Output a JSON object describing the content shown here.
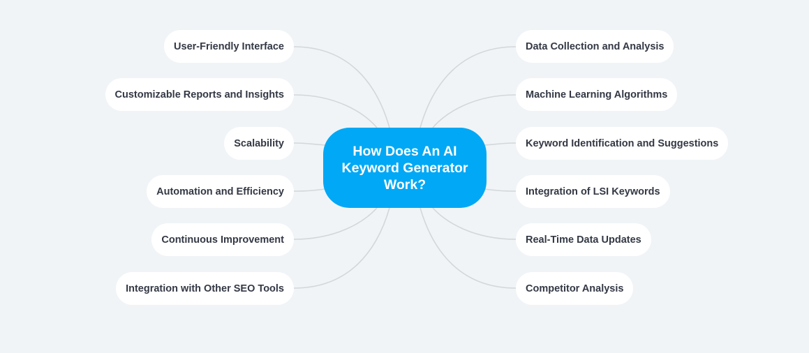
{
  "mindmap": {
    "center": {
      "label": "How Does An AI Keyword Generator Work?",
      "color": "#00a8f5"
    },
    "left": [
      {
        "label": "User-Friendly Interface"
      },
      {
        "label": "Customizable Reports and Insights"
      },
      {
        "label": "Scalability"
      },
      {
        "label": "Automation and Efficiency"
      },
      {
        "label": "Continuous Improvement"
      },
      {
        "label": "Integration with Other SEO Tools"
      }
    ],
    "right": [
      {
        "label": "Data Collection and Analysis"
      },
      {
        "label": "Machine Learning Algorithms"
      },
      {
        "label": "Keyword Identification and Suggestions"
      },
      {
        "label": "Integration of LSI Keywords"
      },
      {
        "label": "Real-Time Data Updates"
      },
      {
        "label": "Competitor Analysis"
      }
    ]
  }
}
